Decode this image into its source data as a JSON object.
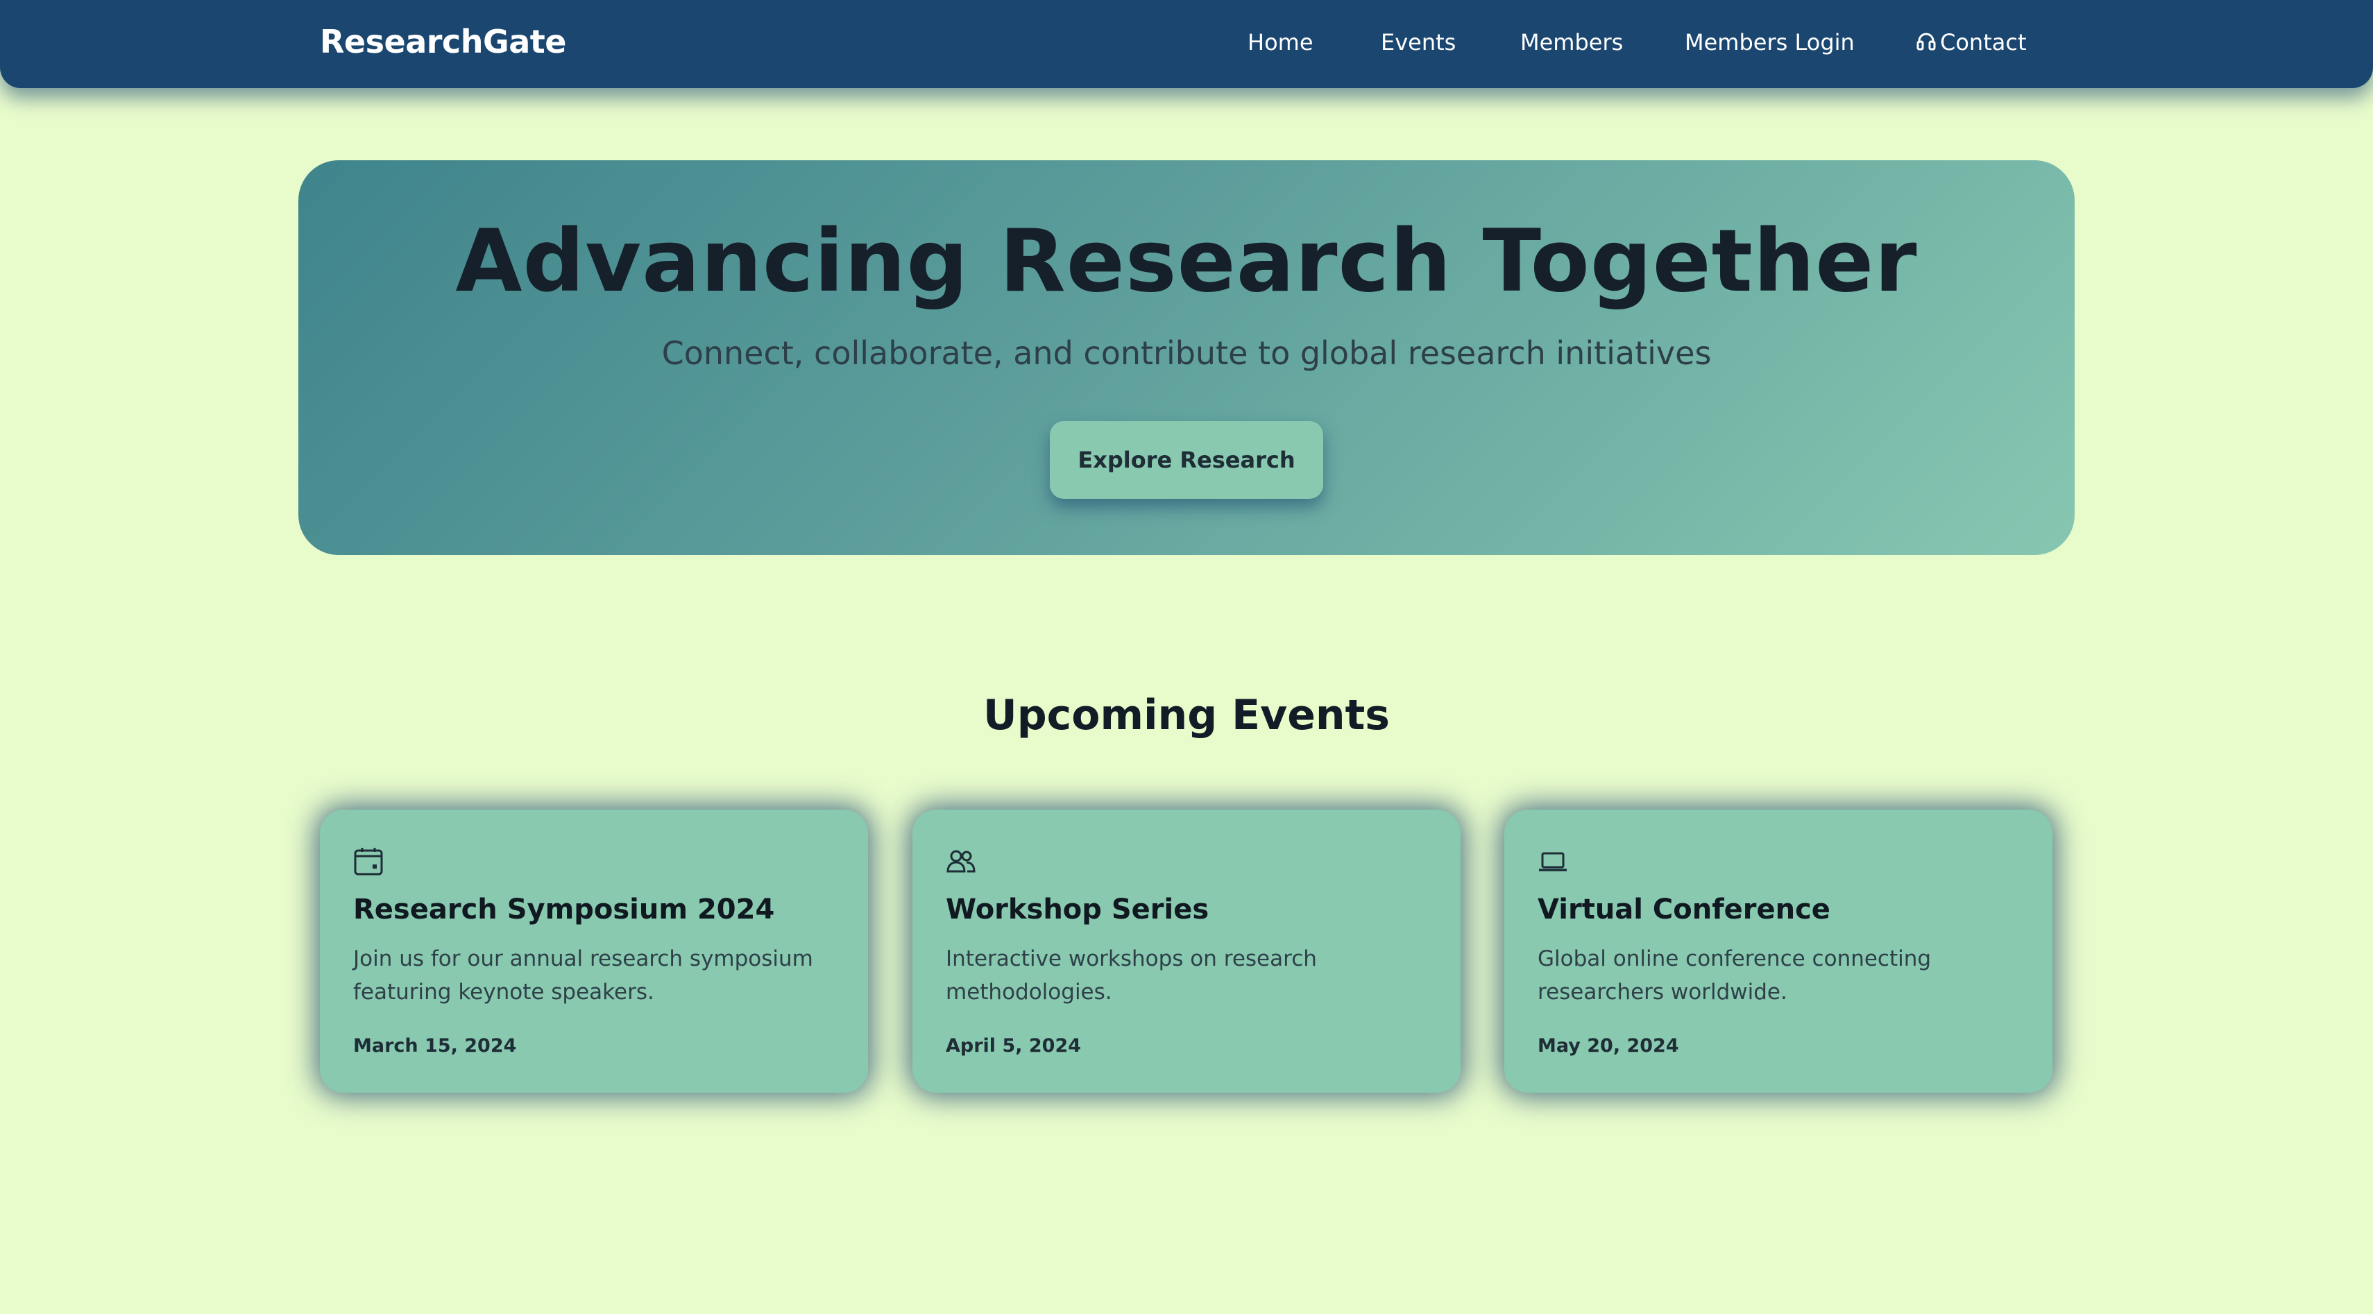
{
  "navbar": {
    "brand": "ResearchGate",
    "links": {
      "home": "Home",
      "events": "Events",
      "members": "Members",
      "login": "Members Login",
      "contact": "Contact"
    },
    "contact_icon": "headset-icon"
  },
  "hero": {
    "title": "Advancing Research Together",
    "subtitle": "Connect, collaborate, and contribute to global research initiatives",
    "button": "Explore Research"
  },
  "events": {
    "title": "Upcoming Events",
    "cards": [
      {
        "icon": "calendar-icon",
        "title": "Research Symposium 2024",
        "description": "Join us for our annual research symposium featuring keynote speakers.",
        "date": "March 15, 2024"
      },
      {
        "icon": "users-icon",
        "title": "Workshop Series",
        "description": "Interactive workshops on research methodologies.",
        "date": "April 5, 2024"
      },
      {
        "icon": "laptop-icon",
        "title": "Virtual Conference",
        "description": "Global online conference connecting researchers worldwide.",
        "date": "May 20, 2024"
      }
    ]
  },
  "colors": {
    "page_background": "#e8fbcb",
    "navbar": "#1a4670",
    "card": "#88c9b0",
    "hero_gradient_start": "#3f848c",
    "hero_gradient_end": "#87c7b1"
  }
}
